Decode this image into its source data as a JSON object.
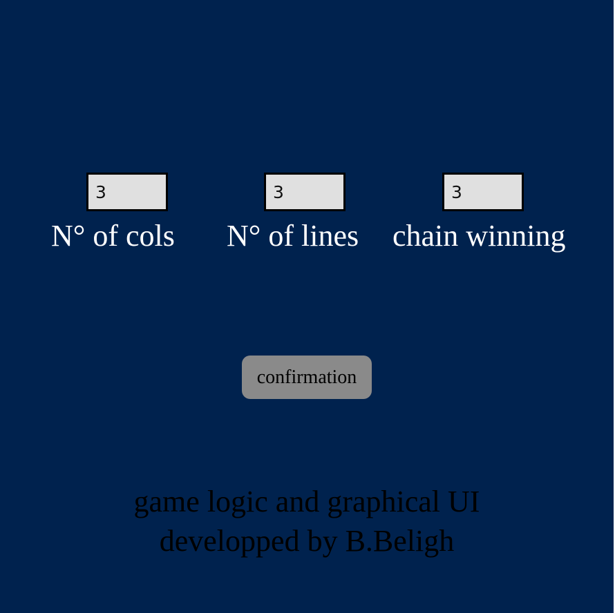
{
  "settings": {
    "cols": {
      "value": "3",
      "label": "N° of cols"
    },
    "lines": {
      "value": "3",
      "label": "N° of lines"
    },
    "chain": {
      "value": "3",
      "label": "chain winning"
    }
  },
  "confirm_button": {
    "label": "confirmation"
  },
  "credits": {
    "line1": "game logic and graphical UI",
    "line2": "developped by B.Beligh"
  },
  "colors": {
    "background": "#00224e",
    "input_background": "#e0e0e0",
    "button_background": "#8a8a8a",
    "label_text": "#ffffff",
    "credits_text": "#000000"
  }
}
